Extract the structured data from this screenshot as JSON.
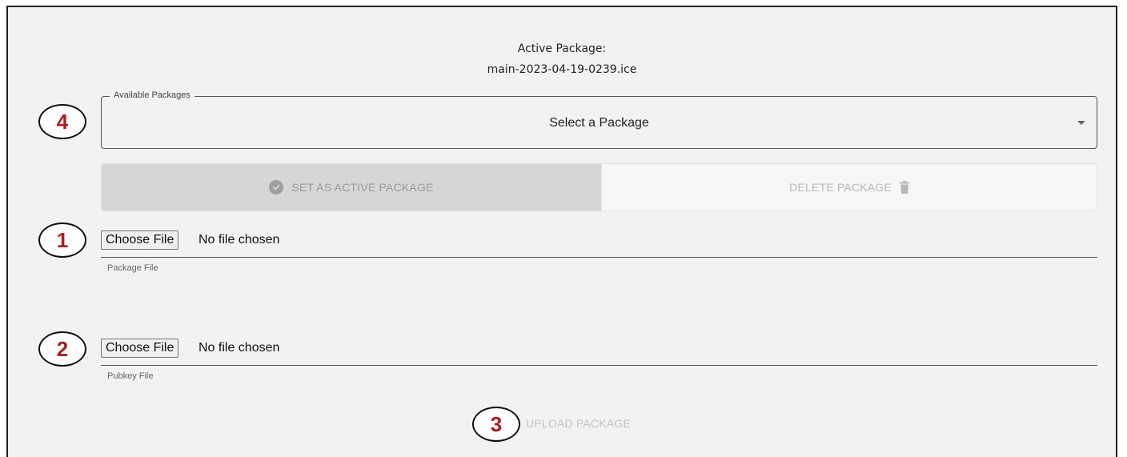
{
  "active_package": {
    "title": "Active Package:",
    "value": "main-2023-04-19-0239.ice"
  },
  "package_select": {
    "legend": "Available Packages",
    "selected_value": "Select a Package"
  },
  "actions": {
    "set_active_label": "SET AS ACTIVE PACKAGE",
    "delete_label": "DELETE PACKAGE"
  },
  "package_file": {
    "button_label": "Choose File",
    "status": "No file chosen",
    "caption": "Package File"
  },
  "pubkey_file": {
    "button_label": "Choose File",
    "status": "No file chosen",
    "caption": "Pubkey File"
  },
  "upload": {
    "label": "UPLOAD PACKAGE"
  },
  "markers": {
    "select": "4",
    "package_file": "1",
    "pubkey_file": "2",
    "upload": "3"
  },
  "colors": {
    "marker_number": "#b01c1c",
    "panel_background": "#f2f2f2",
    "disabled_button": "#d6d6d6",
    "disabled_text": "#9a9a9a"
  },
  "icons": {
    "set_active": "check-circle-icon",
    "delete": "trash-icon",
    "select_caret": "caret-down-icon"
  }
}
